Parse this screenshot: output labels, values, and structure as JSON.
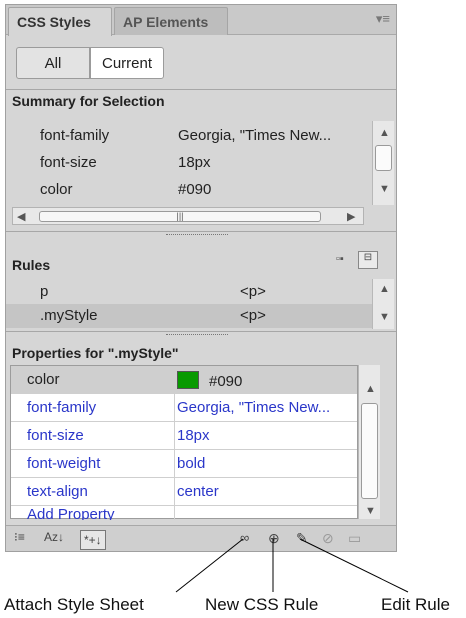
{
  "tabs": [
    {
      "label": "CSS Styles"
    },
    {
      "label": "AP Elements"
    }
  ],
  "panel_menu_icon": "panel-menu-icon",
  "mode_buttons": {
    "all": "All",
    "current": "Current"
  },
  "summary": {
    "title": "Summary for Selection",
    "rows": [
      {
        "property": "font-family",
        "value": "Georgia, \"Times New..."
      },
      {
        "property": "font-size",
        "value": "18px"
      },
      {
        "property": "color",
        "value": "#090"
      }
    ]
  },
  "rules": {
    "title": "Rules",
    "rows": [
      {
        "selector": "p",
        "tag": "<p>"
      },
      {
        "selector": ".myStyle",
        "tag": "<p>"
      }
    ]
  },
  "properties": {
    "title": "Properties for \".myStyle\"",
    "rows": [
      {
        "property": "color",
        "value": "#090",
        "swatch": "#089a00"
      },
      {
        "property": "font-family",
        "value": "Georgia, \"Times New..."
      },
      {
        "property": "font-size",
        "value": "18px"
      },
      {
        "property": "font-weight",
        "value": "bold"
      },
      {
        "property": "text-align",
        "value": "center"
      }
    ],
    "add_label": "Add Property"
  },
  "footer": {
    "az_label": "Az↓",
    "star_label": "*+↓"
  },
  "captions": {
    "attach": "Attach Style Sheet",
    "new_rule": "New CSS Rule",
    "edit": "Edit Rule"
  },
  "colors": {
    "link_blue": "#2a36c9",
    "swatch_green": "#089a00",
    "panel_gray": "#d6d6d6"
  }
}
